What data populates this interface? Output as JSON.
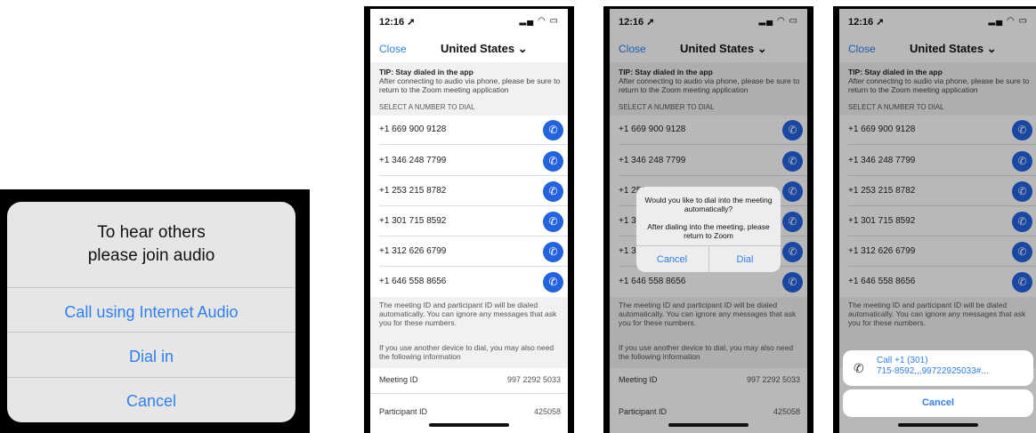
{
  "panel1": {
    "title_line1": "To hear others",
    "title_line2": "please join audio",
    "option_internet": "Call using Internet Audio",
    "option_dial_in": "Dial in",
    "option_cancel": "Cancel"
  },
  "phone": {
    "time": "12:16",
    "close": "Close",
    "country": "United States",
    "tip_title": "TIP: Stay dialed in the app",
    "tip_body": "After connecting to audio via phone, please be sure to return to the Zoom meeting application",
    "select_header": "SELECT A NUMBER TO DIAL",
    "numbers": [
      "+1 669 900 9128",
      "+1 346 248 7799",
      "+1 253 215 8782",
      "+1 301 715 8592",
      "+1 312 626 6799",
      "+1 646 558 8656"
    ],
    "info1": "The meeting ID and participant ID will be dialed automatically. You can ignore any messages that ask you for these numbers.",
    "info2": "If you use another device to dial, you may also need the following information",
    "meeting_id_label": "Meeting ID",
    "meeting_id_value": "997 2292 5033",
    "participant_id_label": "Participant ID",
    "participant_id_value": "425058"
  },
  "dialog": {
    "question": "Would you like to dial into the meeting automatically?",
    "note": "After dialing into the meeting, please return to Zoom",
    "cancel": "Cancel",
    "dial": "Dial"
  },
  "action_sheet": {
    "call_line1": "Call +1 (301)",
    "call_line2": "715-8592,,,99722925033#...",
    "cancel": "Cancel"
  },
  "colors": {
    "accent": "#2f80ed",
    "call_button": "#2463e0"
  }
}
